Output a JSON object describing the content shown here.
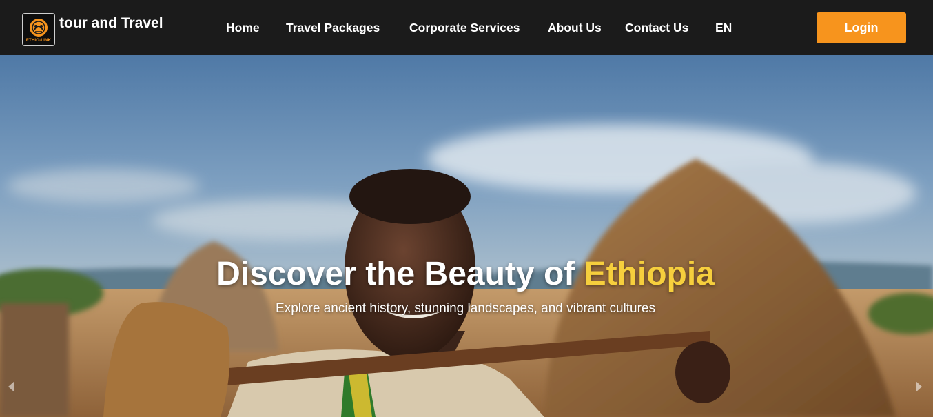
{
  "brand": {
    "logo_caption": "ETHIO-LINK",
    "name": "tour and Travel",
    "logo_icon": "ethio-link-logo-icon",
    "accent_color": "#f7941d"
  },
  "nav": {
    "items": [
      {
        "label": "Home"
      },
      {
        "label": "Travel Packages"
      },
      {
        "label": "Corporate Services"
      },
      {
        "label": "About Us"
      },
      {
        "label": "Contact Us"
      },
      {
        "label": "EN"
      }
    ],
    "login_label": "Login"
  },
  "hero": {
    "title_prefix": "Discover the Beauty of ",
    "title_highlight": "Ethiopia",
    "highlight_color": "#f6cf3d",
    "subtitle": "Explore ancient history, stunning landscapes, and vibrant cultures",
    "prev_icon": "chevron-left-icon",
    "next_icon": "chevron-right-icon"
  }
}
